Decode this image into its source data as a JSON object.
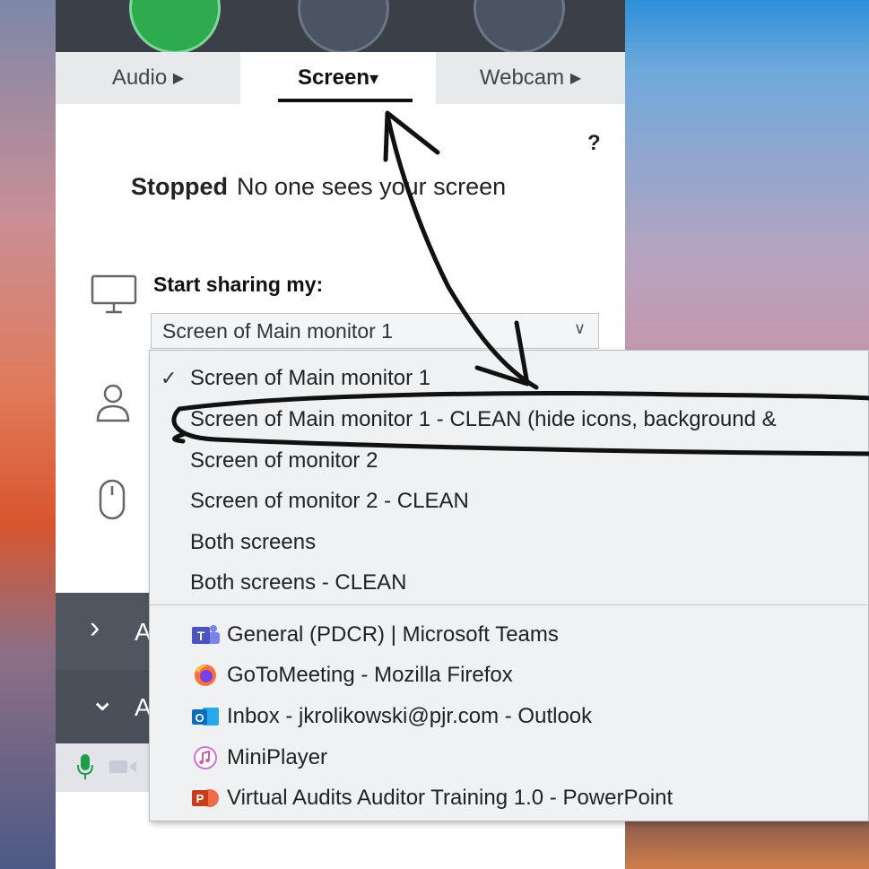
{
  "tabs": [
    {
      "label": "Audio",
      "arrow": "▶"
    },
    {
      "label": "Screen",
      "arrow": "▾"
    },
    {
      "label": "Webcam",
      "arrow": "▶"
    }
  ],
  "help": "?",
  "status": {
    "state": "Stopped",
    "text": "No one sees your screen"
  },
  "share": {
    "title": "Start sharing my:",
    "selected": "Screen of Main monitor 1"
  },
  "menu": {
    "check": "✓",
    "screen_options": [
      "Screen of Main monitor 1",
      "Screen of Main monitor 1 - CLEAN (hide icons, background &",
      "Screen of monitor 2",
      "Screen of monitor 2 - CLEAN",
      "Both screens",
      "Both screens - CLEAN"
    ],
    "apps": [
      {
        "label": "General (PDCR) | Microsoft Teams",
        "icon": "teams-icon",
        "color": "#5059c9"
      },
      {
        "label": "GoToMeeting - Mozilla Firefox",
        "icon": "firefox-icon",
        "color": "#e8612c"
      },
      {
        "label": "Inbox - jkrolikowski@pjr.com - Outlook",
        "icon": "outlook-icon",
        "color": "#0f6cbd"
      },
      {
        "label": "MiniPlayer",
        "icon": "itunes-icon",
        "color": "#c977d9"
      },
      {
        "label": "Virtual Audits Auditor Training 1.0 - PowerPoint",
        "icon": "powerpoint-icon",
        "color": "#d35230"
      }
    ]
  },
  "collapsed": [
    {
      "chevron": "›",
      "label": "A"
    },
    {
      "chevron": "⌄",
      "label": "A"
    }
  ],
  "colors": {
    "annotation": "#111111",
    "mic": "#1e9e4a"
  }
}
